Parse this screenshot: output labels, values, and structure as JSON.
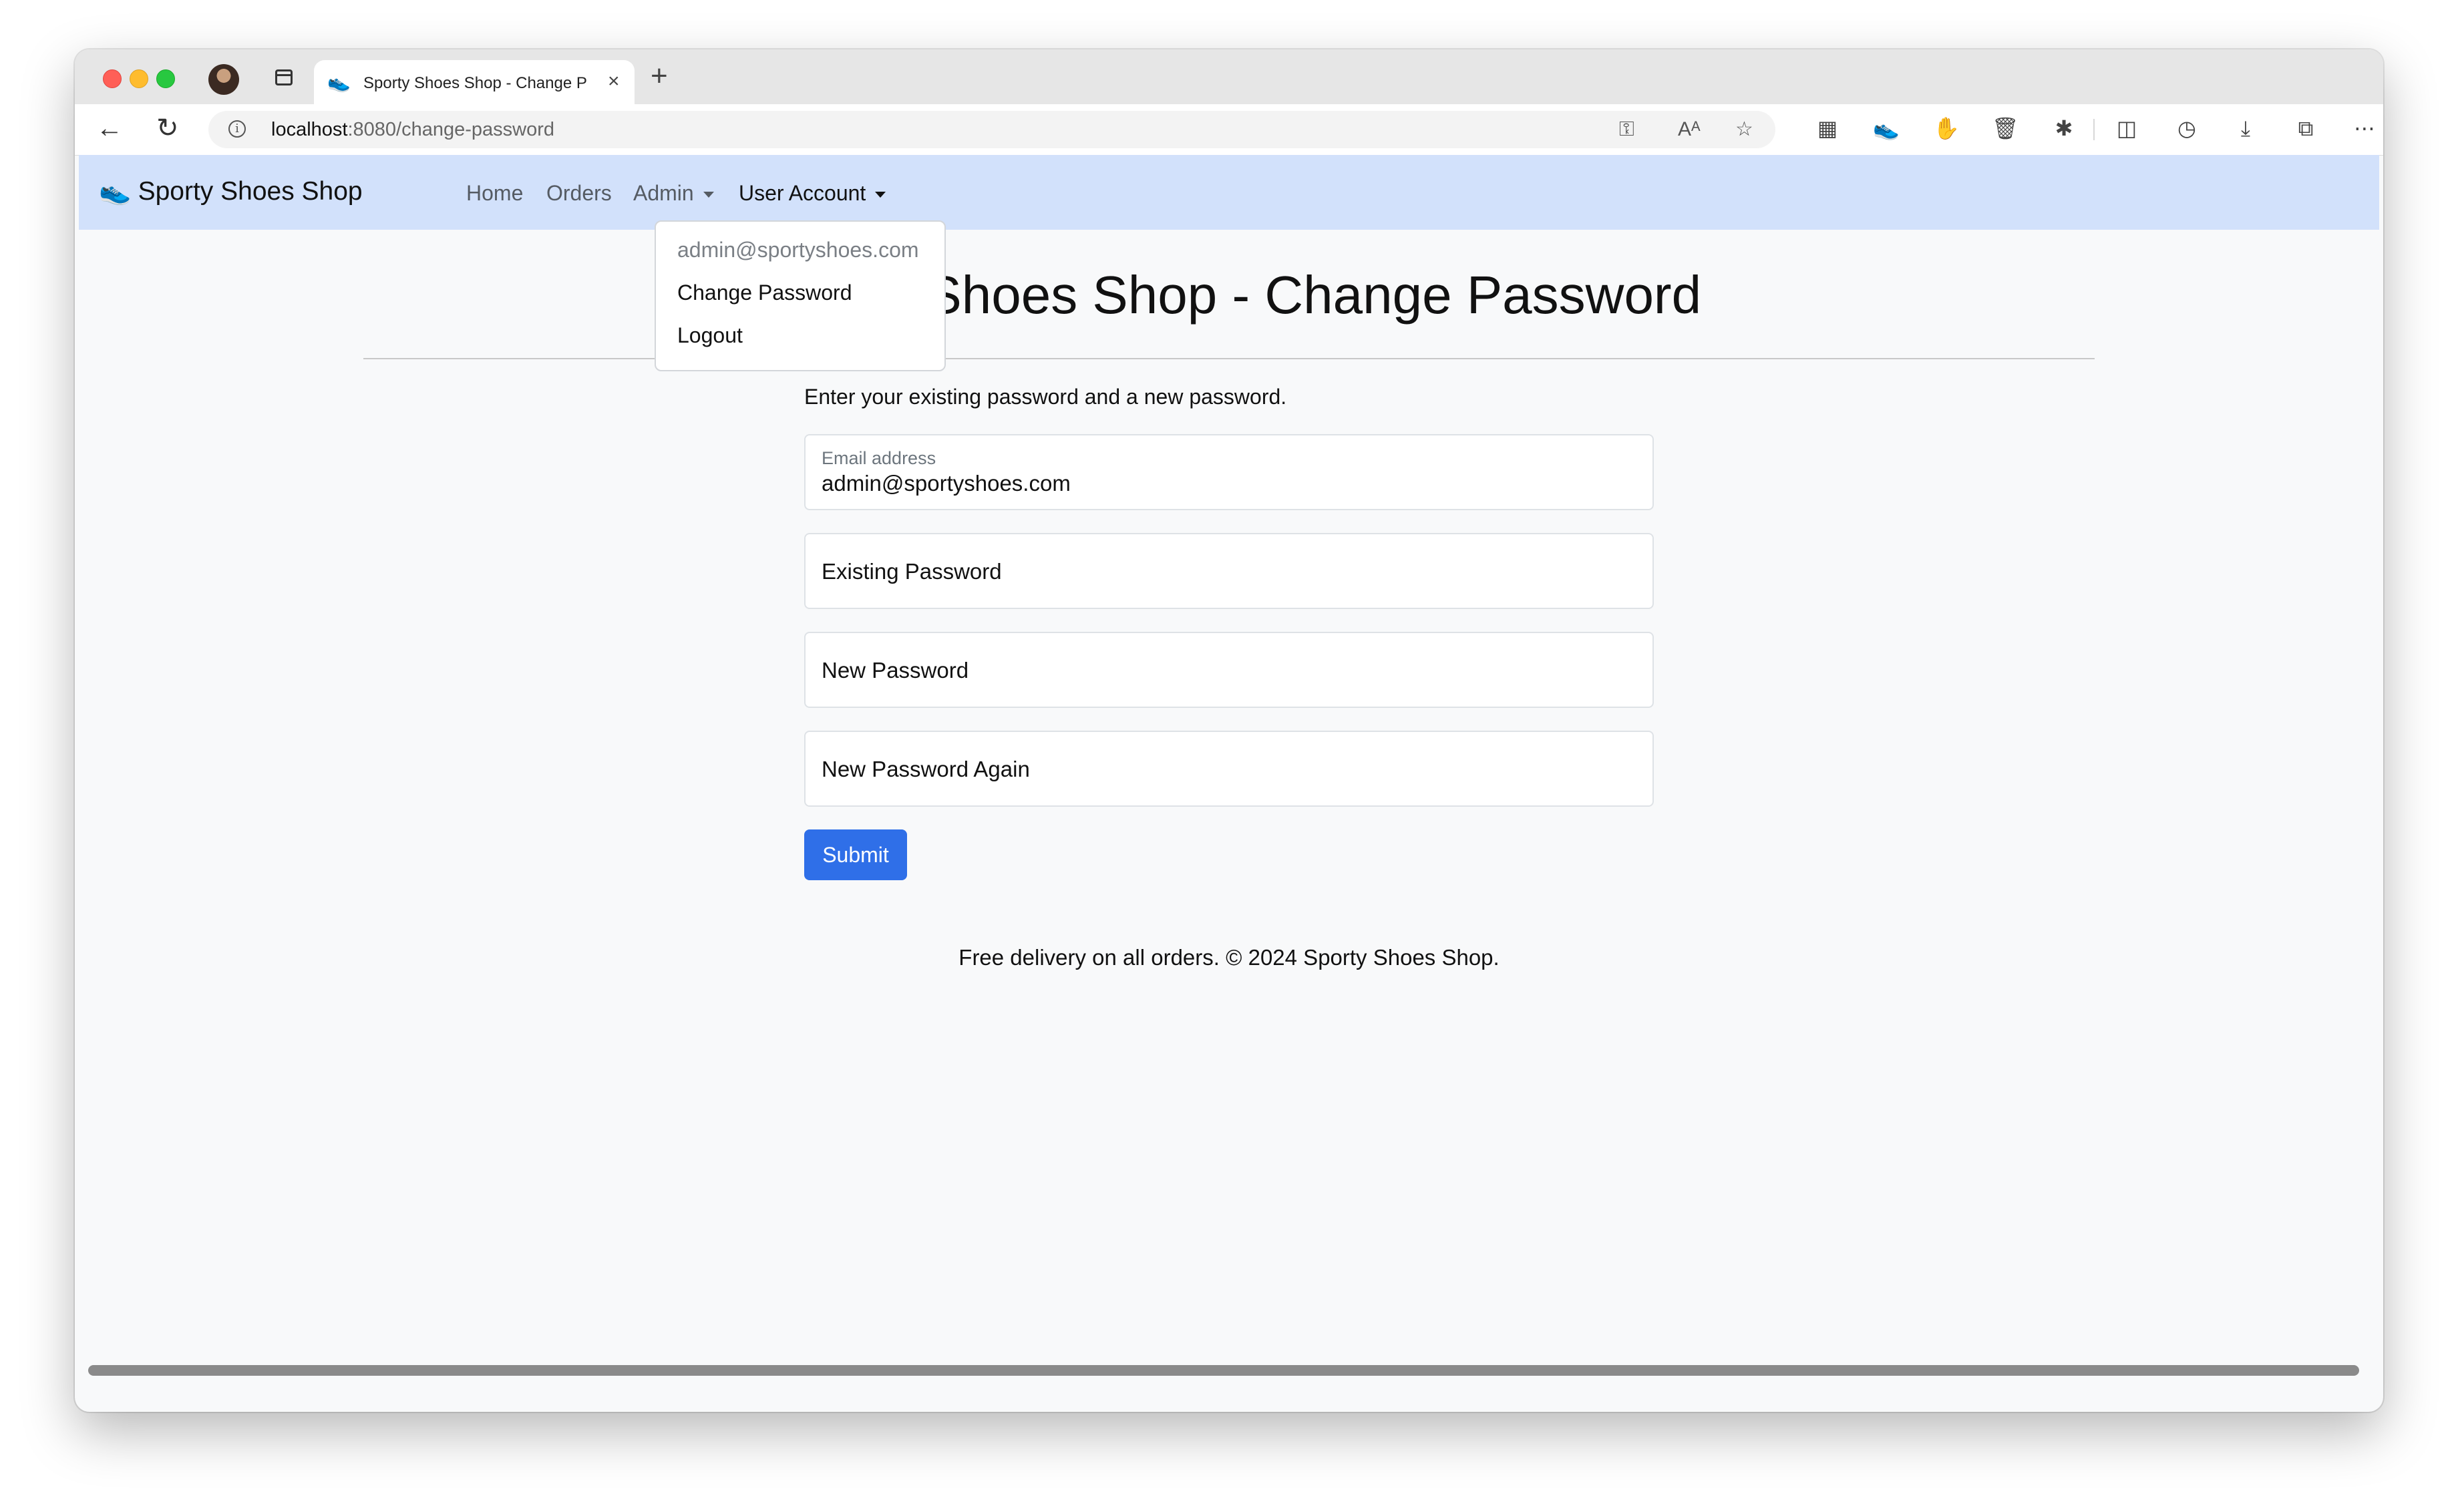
{
  "browser": {
    "tab_title": "Sporty Shoes Shop - Change P",
    "tab_favicon": "shoe-icon",
    "new_tab": "+",
    "tab_close": "×",
    "url_host": "localhost",
    "url_path": ":8080/change-password"
  },
  "navbar": {
    "brand": "Sporty Shoes Shop",
    "links": [
      "Home",
      "Orders",
      "Admin",
      "User Account"
    ]
  },
  "dropdown": {
    "header": "admin@sportyshoes.com",
    "items": [
      "Change Password",
      "Logout"
    ]
  },
  "page": {
    "title": "Sporty Shoes Shop - Change Password",
    "intro": "Enter your existing password and a new password."
  },
  "form": {
    "email_label": "Email address",
    "email_value": "admin@sportyshoes.com",
    "existing_password": "Existing Password",
    "new_password": "New Password",
    "new_password_again": "New Password Again",
    "submit": "Submit"
  },
  "footer": {
    "text": "Free delivery on all orders. © 2024 Sporty Shoes Shop."
  },
  "colors": {
    "navbar_bg": "#d2e1fb",
    "primary_button": "#2f6fe8",
    "page_bg": "#f8f9fa"
  }
}
